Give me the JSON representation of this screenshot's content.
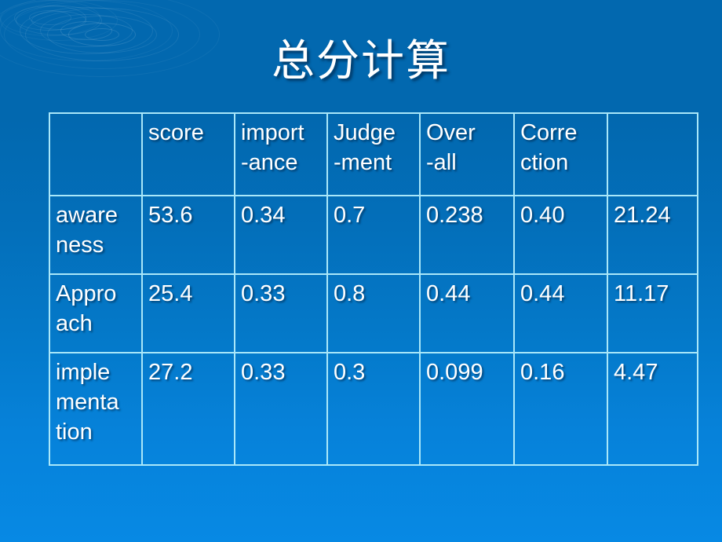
{
  "slide": {
    "title": "总分计算",
    "background_top_color": "#0268af",
    "background_bottom_color": "#0789e4",
    "table_border_color": "#a9e7f9",
    "text_color": "#ffffff"
  },
  "table": {
    "headers": [
      {
        "lines": [
          ""
        ]
      },
      {
        "lines": [
          "score"
        ]
      },
      {
        "lines": [
          "import",
          "-ance"
        ]
      },
      {
        "lines": [
          "Judge",
          "-ment"
        ]
      },
      {
        "lines": [
          "Over",
          "-all"
        ]
      },
      {
        "lines": [
          "Corre",
          "ction"
        ]
      },
      {
        "lines": [
          ""
        ]
      }
    ],
    "rows": [
      {
        "label_lines": [
          "aware",
          "ness"
        ],
        "cells": [
          "53.6",
          "0.34",
          "0.7",
          "0.238",
          "0.40",
          "21.24"
        ]
      },
      {
        "label_lines": [
          "Appro",
          "ach"
        ],
        "cells": [
          "25.4",
          "0.33",
          "0.8",
          "0.44",
          "0.44",
          "11.17"
        ]
      },
      {
        "label_lines": [
          "imple",
          "menta",
          "tion"
        ],
        "cells": [
          "27.2",
          "0.33",
          "0.3",
          "0.099",
          "0.16",
          "4.47"
        ]
      }
    ]
  },
  "chart_data": {
    "type": "table",
    "title": "总分计算",
    "columns": [
      "",
      "score",
      "import-ance",
      "Judge-ment",
      "Over-all",
      "Correction",
      ""
    ],
    "rows": [
      [
        "awareness",
        "53.6",
        "0.34",
        "0.7",
        "0.238",
        "0.40",
        "21.24"
      ],
      [
        "Approach",
        "25.4",
        "0.33",
        "0.8",
        "0.44",
        "0.44",
        "11.17"
      ],
      [
        "implementation",
        "27.2",
        "0.33",
        "0.3",
        "0.099",
        "0.16",
        "4.47"
      ]
    ]
  }
}
